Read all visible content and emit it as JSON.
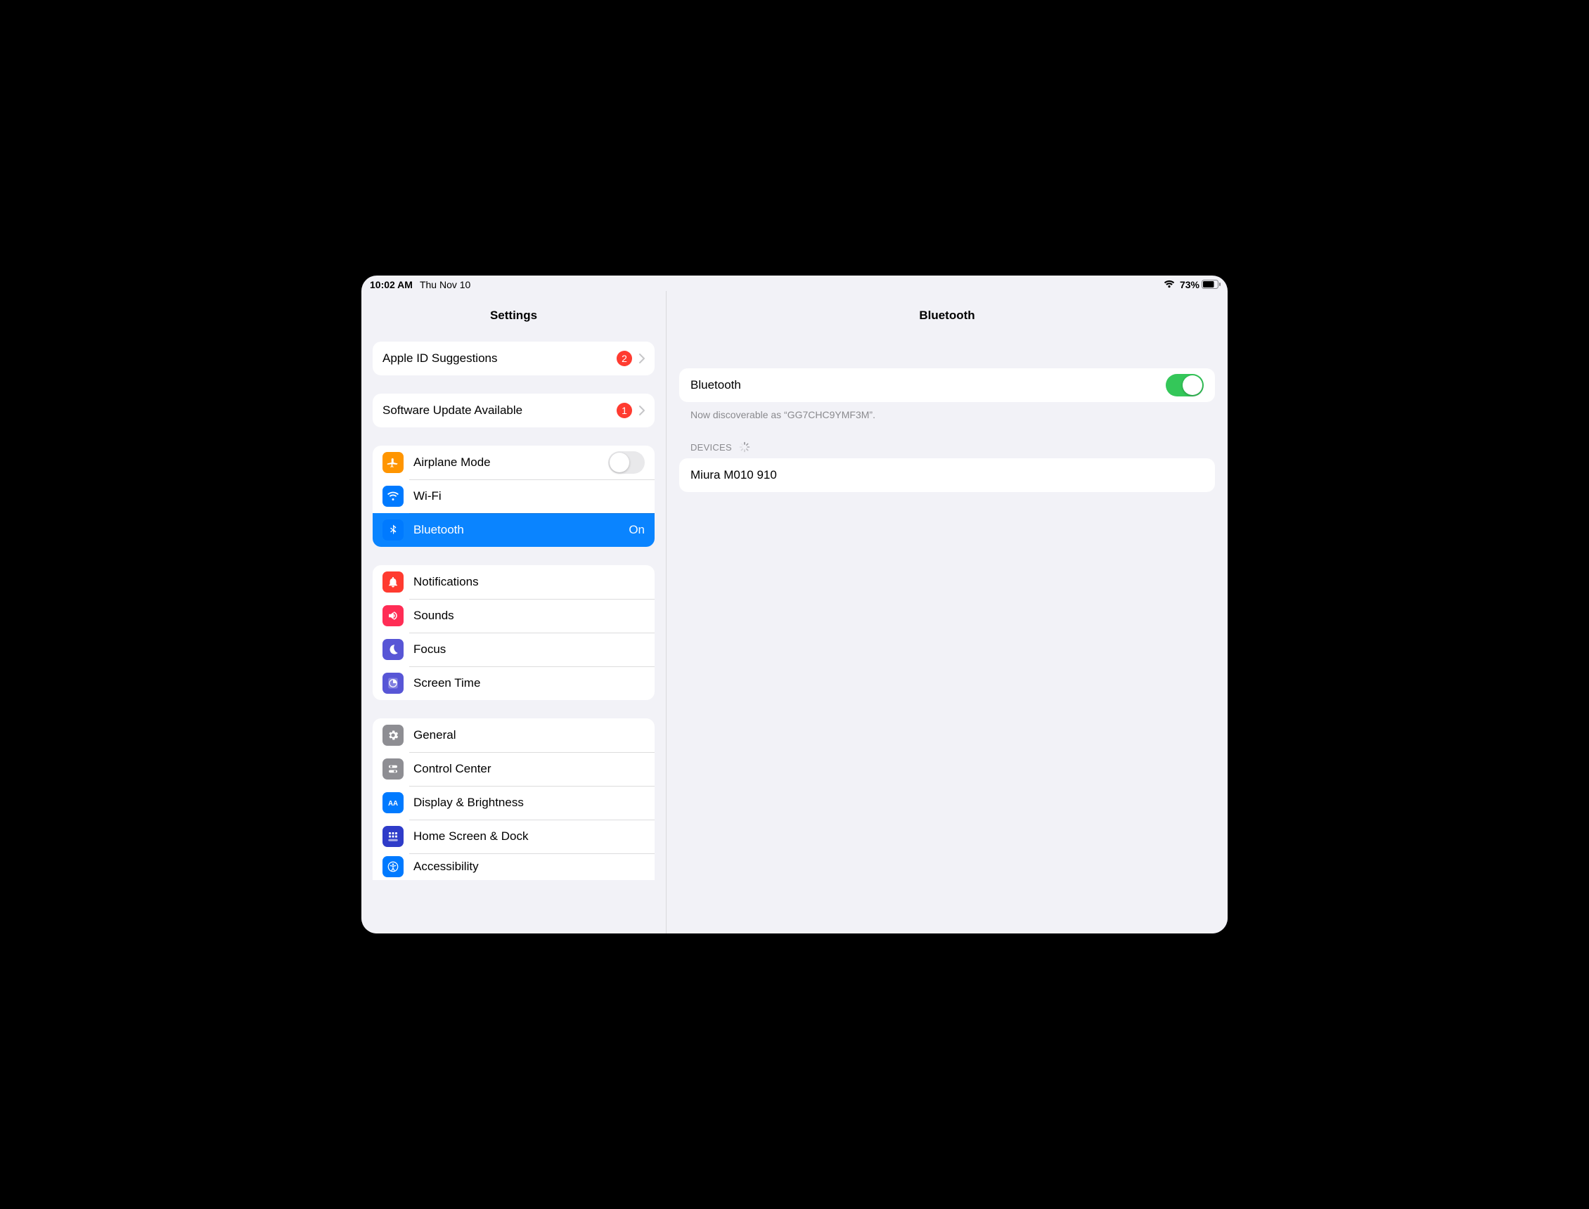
{
  "statusbar": {
    "time": "10:02 AM",
    "date": "Thu Nov 10",
    "battery_pct": "73%"
  },
  "sidebar": {
    "title": "Settings",
    "apple_id": {
      "label": "Apple ID Suggestions",
      "badge": "2"
    },
    "software_update": {
      "label": "Software Update Available",
      "badge": "1"
    },
    "airplane": {
      "label": "Airplane Mode"
    },
    "wifi": {
      "label": "Wi-Fi"
    },
    "bluetooth": {
      "label": "Bluetooth",
      "value": "On"
    },
    "notifications": {
      "label": "Notifications"
    },
    "sounds": {
      "label": "Sounds"
    },
    "focus": {
      "label": "Focus"
    },
    "screentime": {
      "label": "Screen Time"
    },
    "general": {
      "label": "General"
    },
    "controlcenter": {
      "label": "Control Center"
    },
    "display": {
      "label": "Display & Brightness"
    },
    "homescreen": {
      "label": "Home Screen & Dock"
    },
    "accessibility": {
      "label": "Accessibility"
    }
  },
  "detail": {
    "title": "Bluetooth",
    "toggle_label": "Bluetooth",
    "toggle_on": true,
    "discoverable_note": "Now discoverable as “GG7CHC9YMF3M”.",
    "devices_header": "DEVICES",
    "devices": [
      {
        "name": "Miura M010 910"
      }
    ]
  }
}
